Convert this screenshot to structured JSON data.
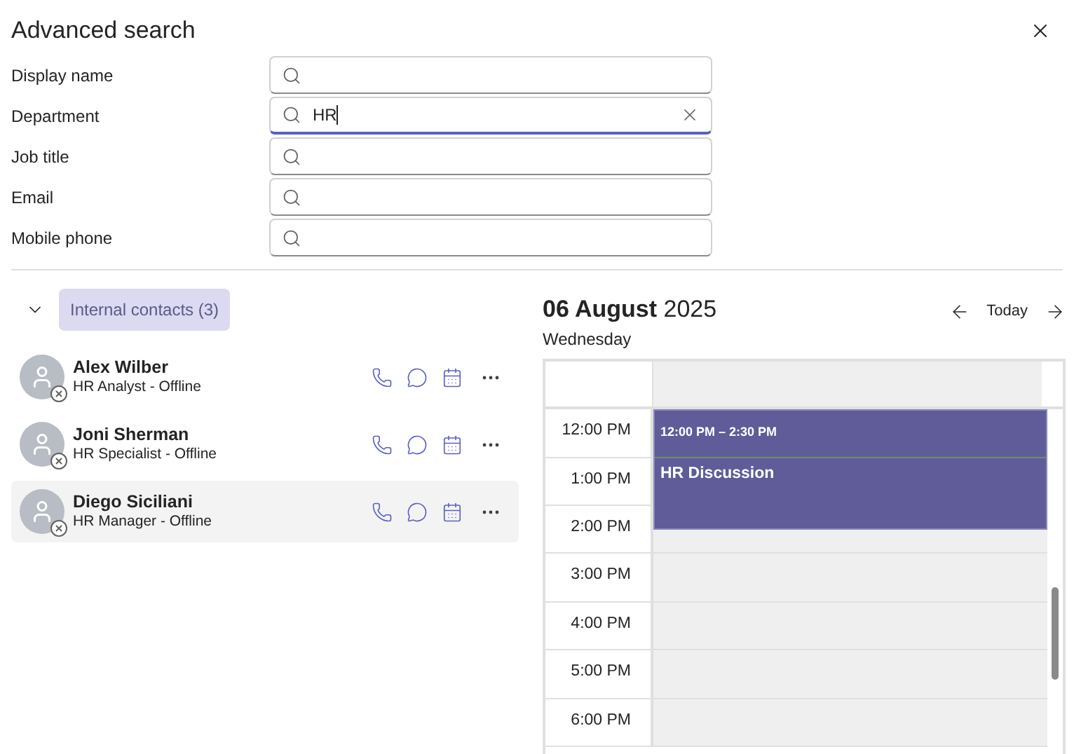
{
  "dialog": {
    "title": "Advanced search"
  },
  "fields": [
    {
      "label": "Display name",
      "focused": false
    },
    {
      "label": "Department",
      "value": "HR",
      "focused": true
    },
    {
      "label": "Job title",
      "focused": false
    },
    {
      "label": "Email",
      "focused": false
    },
    {
      "label": "Mobile phone",
      "focused": false
    }
  ],
  "contacts_group": {
    "label": "Internal contacts (3)",
    "expanded": true
  },
  "contacts": [
    {
      "name": "Alex Wilber",
      "detail": "HR Analyst - Offline",
      "selected": false
    },
    {
      "name": "Joni Sherman",
      "detail": "HR Specialist - Offline",
      "selected": false
    },
    {
      "name": "Diego Siciliani",
      "detail": "HR Manager - Offline",
      "selected": true
    }
  ],
  "calendar": {
    "date": "**06 August** 2025",
    "weekday": "Wednesday",
    "today_label": "Today",
    "hours": [
      "12:00 PM",
      "1:00 PM",
      "2:00 PM",
      "3:00 PM",
      "4:00 PM",
      "5:00 PM",
      "6:00 PM"
    ],
    "event": {
      "time": "12:00 PM – 2:30 PM",
      "title": "HR Discussion"
    }
  }
}
